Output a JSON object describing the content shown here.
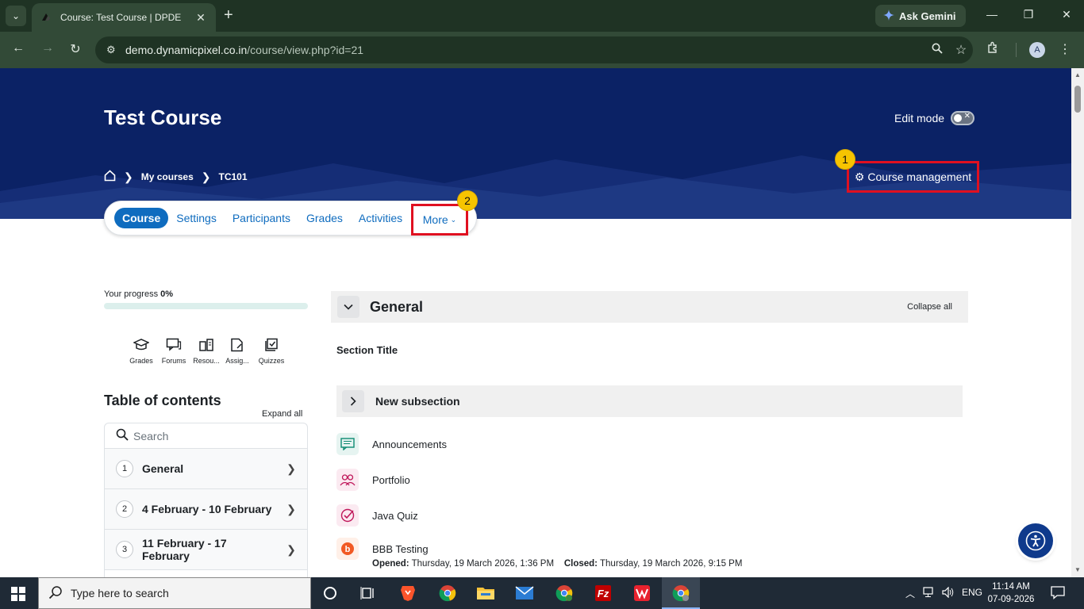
{
  "browser": {
    "tab_title": "Course: Test Course | DPDE",
    "gemini_label": "Ask Gemini",
    "url_host": "demo.dynamicpixel.co.in",
    "url_path": "/course/view.php?id=21",
    "profile_initial": "A"
  },
  "header": {
    "course_title": "Test Course",
    "edit_mode_label": "Edit mode",
    "edit_mode_on": false,
    "breadcrumb": [
      "My courses",
      "TC101"
    ],
    "course_management_label": "Course management",
    "badge_1": "1",
    "badge_2": "2"
  },
  "secondary_nav": {
    "items": [
      "Course",
      "Settings",
      "Participants",
      "Grades",
      "Activities"
    ],
    "more_label": "More",
    "active": "Course"
  },
  "sidebar": {
    "progress_label": "Your progress",
    "progress_value": "0%",
    "progress_fraction": 0,
    "quick_links": [
      {
        "label": "Grades",
        "icon": "mortarboard-icon"
      },
      {
        "label": "Forums",
        "icon": "forum-icon"
      },
      {
        "label": "Resou...",
        "icon": "resources-icon"
      },
      {
        "label": "Assig...",
        "icon": "assignment-icon"
      },
      {
        "label": "Quizzes",
        "icon": "quiz-icon"
      }
    ],
    "toc_title": "Table of contents",
    "expand_all": "Expand all",
    "search_placeholder": "Search",
    "toc_items": [
      {
        "num": "1",
        "label": "General"
      },
      {
        "num": "2",
        "label": "4 February - 10 February"
      },
      {
        "num": "3",
        "label": "11 February - 17 February"
      }
    ]
  },
  "main": {
    "section_name": "General",
    "collapse_all": "Collapse all",
    "section_title": "Section Title",
    "subsection_name": "New subsection",
    "activities": [
      {
        "name": "Announcements",
        "icon": "announcement-icon",
        "color": "#0d8a72"
      },
      {
        "name": "Portfolio",
        "icon": "people-icon",
        "color": "#c0185b"
      },
      {
        "name": "Java Quiz",
        "icon": "quiz-check-icon",
        "color": "#c0185b"
      },
      {
        "name": "BBB Testing",
        "icon": "bigbluebutton-icon",
        "color": "#f15a24"
      }
    ],
    "bbb_opened_label": "Opened:",
    "bbb_opened_value": "Thursday, 19 March 2026, 1:36 PM",
    "bbb_closed_label": "Closed:",
    "bbb_closed_value": "Thursday, 19 March 2026, 9:15 PM"
  },
  "taskbar": {
    "search_placeholder": "Type here to search",
    "language": "ENG",
    "time": "11:14 AM",
    "date": "07-09-2026"
  },
  "colors": {
    "hero_bg": "#0b2265",
    "primary": "#0f6cbf",
    "highlight_box": "#e01020",
    "badge": "#f6c400"
  }
}
